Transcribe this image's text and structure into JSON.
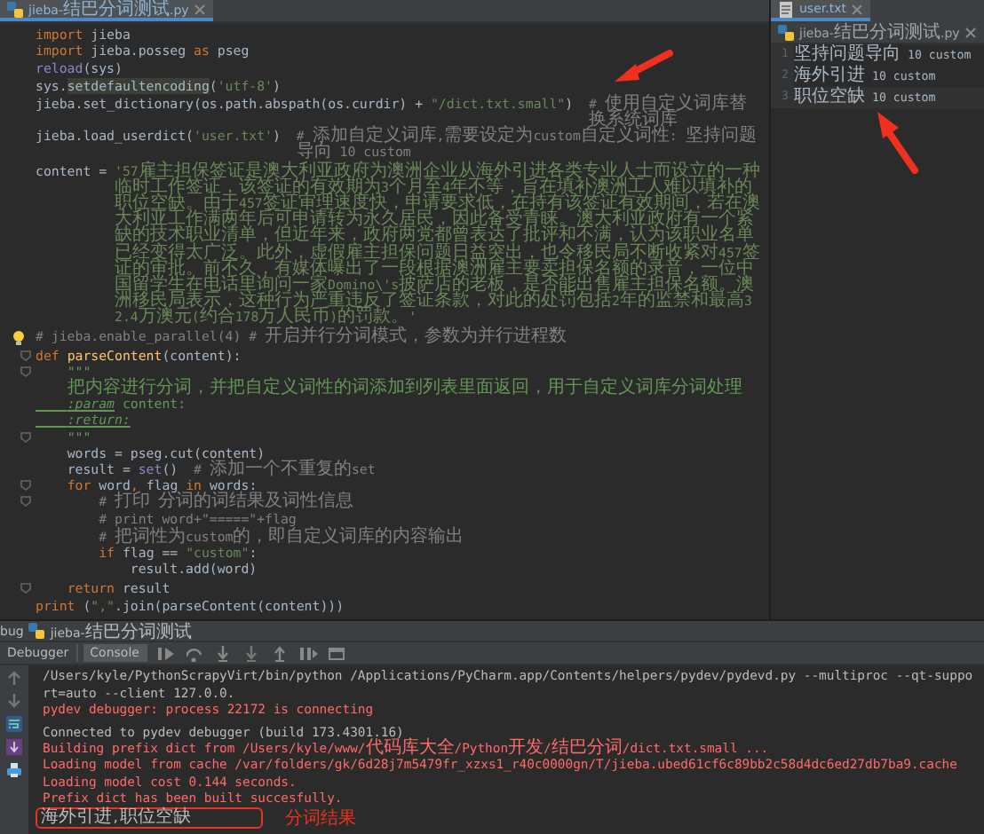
{
  "editor": {
    "tab": {
      "label": "jieba-结巴分词测试.py",
      "selected": true
    },
    "lines": [
      {
        "space_before": true,
        "fold": false,
        "bulb": false,
        "tokens": [
          {
            "kind": "keyword",
            "text": "import"
          },
          {
            "kind": "plain",
            "text": " jieba"
          }
        ]
      },
      {
        "space_before": false,
        "fold": false,
        "bulb": false,
        "tokens": [
          {
            "kind": "keyword",
            "text": "import"
          },
          {
            "kind": "plain",
            "text": " jieba.posseg "
          },
          {
            "kind": "keyword",
            "text": "as"
          },
          {
            "kind": "plain",
            "text": " pseg"
          }
        ]
      },
      {
        "space_before": true,
        "fold": false,
        "bulb": false,
        "tokens": [
          {
            "kind": "builtin",
            "text": "reload"
          },
          {
            "kind": "plain",
            "text": "(sys)"
          }
        ]
      },
      {
        "space_before": false,
        "fold": false,
        "bulb": false,
        "tokens": [
          {
            "kind": "plain",
            "text": "sys."
          },
          {
            "kind": "marked",
            "text": "setdefaultencoding"
          },
          {
            "kind": "plain",
            "text": "("
          },
          {
            "kind": "string",
            "text": "'utf-8'"
          },
          {
            "kind": "plain",
            "text": ")"
          }
        ]
      },
      {
        "space_before": true,
        "fold": false,
        "bulb": false,
        "tokens": [
          {
            "kind": "plain",
            "text": "jieba.set_dictionary(os.path.abspath(os.curdir) + "
          },
          {
            "kind": "string",
            "text": "\"/dict.txt.small\""
          },
          {
            "kind": "plain",
            "text": ")  "
          },
          {
            "kind": "comment",
            "text": "# 使用自定义词库替换系统词库"
          }
        ]
      },
      {
        "space_before": false,
        "fold": false,
        "bulb": false,
        "tokens": [
          {
            "kind": "plain",
            "text": "jieba.load_userdict("
          },
          {
            "kind": "string",
            "text": "'user.txt'"
          },
          {
            "kind": "plain",
            "text": ")  "
          },
          {
            "kind": "comment",
            "text": "# 添加自定义词库,需要设定为custom自定义词性: 坚持问题导向 10 custom"
          }
        ]
      },
      {
        "space_before": true,
        "fold": false,
        "bulb": false,
        "tokens": [
          {
            "kind": "plain",
            "text": "content = "
          },
          {
            "kind": "string",
            "text": "'57雇主担保签证是澳大利亚政府为澳洲企业从海外引进各类专业人士而设立的一种临时工作签证，该签证的有效期为3个月至4年不等，旨在填补澳洲工人难以填补的职位空缺。由于457签证审理速度快，申请要求低，在持有该签证有效期间，若在澳大利亚工作满两年后可申请转为永久居民，因此备受青睐。澳大利亚政府有一个紧缺的技术职业清单，但近年来，政府两党都曾表达了批评和不满，认为该职业名单已经变得太广泛。此外，虚假雇主担保问题日益突出，也令移民局不断收紧对457签证的审批。前不久，有媒体曝出了一段根据澳洲雇主要卖担保名额的录音，一位中国留学生在电话里询问一家Domino\\'s披萨店的老板，是否能出售雇主担保名额。澳洲移民局表示，这种行为严重违反了签证条款，对此的处罚包括2年的监禁和最高32.4万澳元(约合178万人民币)的罚款。'"
          }
        ]
      },
      {
        "space_before": true,
        "fold": false,
        "bulb": true,
        "tokens": [
          {
            "kind": "comment",
            "text": "# jieba.enable_parallel(4) # 开启并行分词模式，参数为并行进程数"
          }
        ]
      },
      {
        "space_before": true,
        "fold": true,
        "bulb": false,
        "tokens": [
          {
            "kind": "keyword",
            "text": "def "
          },
          {
            "kind": "function",
            "text": "parseContent"
          },
          {
            "kind": "plain",
            "text": "(content):"
          }
        ]
      },
      {
        "space_before": false,
        "fold": true,
        "bulb": false,
        "tokens": [
          {
            "kind": "doc",
            "text": "    \"\"\""
          }
        ]
      },
      {
        "space_before": false,
        "fold": false,
        "bulb": false,
        "tokens": [
          {
            "kind": "doc",
            "text": "    把内容进行分词，并把自定义词性的词添加到列表里面返回，用于自定义词库分词处理"
          }
        ]
      },
      {
        "space_before": false,
        "fold": false,
        "bulb": false,
        "tokens": [
          {
            "kind": "doctag",
            "text": "    :param"
          },
          {
            "kind": "doc",
            "text": " content:"
          }
        ]
      },
      {
        "space_before": false,
        "fold": false,
        "bulb": false,
        "tokens": [
          {
            "kind": "doctag",
            "text": "    :return:"
          }
        ]
      },
      {
        "space_before": false,
        "fold": true,
        "bulb": false,
        "tokens": [
          {
            "kind": "doc",
            "text": "    \"\"\""
          }
        ]
      },
      {
        "space_before": false,
        "fold": false,
        "bulb": false,
        "tokens": [
          {
            "kind": "plain",
            "text": "    words = pseg.cut(content)"
          }
        ]
      },
      {
        "space_before": false,
        "fold": false,
        "bulb": false,
        "tokens": [
          {
            "kind": "plain",
            "text": "    result = "
          },
          {
            "kind": "builtin",
            "text": "set"
          },
          {
            "kind": "plain",
            "text": "()  "
          },
          {
            "kind": "comment",
            "text": "# 添加一个不重复的set"
          }
        ]
      },
      {
        "space_before": false,
        "fold": true,
        "bulb": false,
        "tokens": [
          {
            "kind": "keyword",
            "text": "    for"
          },
          {
            "kind": "plain",
            "text": " word"
          },
          {
            "kind": "keyword",
            "text": ","
          },
          {
            "kind": "plain",
            "text": " flag "
          },
          {
            "kind": "keyword",
            "text": "in"
          },
          {
            "kind": "plain",
            "text": " words:"
          }
        ]
      },
      {
        "space_before": false,
        "fold": true,
        "bulb": false,
        "tokens": [
          {
            "kind": "comment",
            "text": "        # 打印 分词的词结果及词性信息"
          }
        ]
      },
      {
        "space_before": false,
        "fold": false,
        "bulb": false,
        "tokens": [
          {
            "kind": "comment",
            "text": "        # print word+\"=====\"+flag"
          }
        ]
      },
      {
        "space_before": true,
        "fold": false,
        "bulb": false,
        "tokens": [
          {
            "kind": "comment",
            "text": "        # 把词性为custom的，即自定义词库的内容输出"
          }
        ]
      },
      {
        "space_before": false,
        "fold": false,
        "bulb": false,
        "tokens": [
          {
            "kind": "keyword",
            "text": "        if"
          },
          {
            "kind": "plain",
            "text": " flag == "
          },
          {
            "kind": "string",
            "text": "\"custom\""
          },
          {
            "kind": "plain",
            "text": ":"
          }
        ]
      },
      {
        "space_before": false,
        "fold": false,
        "bulb": false,
        "tokens": [
          {
            "kind": "plain",
            "text": "            result.add(word)"
          }
        ]
      },
      {
        "space_before": true,
        "fold": true,
        "bulb": false,
        "tokens": [
          {
            "kind": "keyword",
            "text": "    return"
          },
          {
            "kind": "plain",
            "text": " result"
          }
        ]
      },
      {
        "space_before": true,
        "fold": false,
        "bulb": false,
        "tokens": [
          {
            "kind": "keyword",
            "text": "print"
          },
          {
            "kind": "plain",
            "text": " ("
          },
          {
            "kind": "string",
            "text": "\",\""
          },
          {
            "kind": "plain",
            "text": ".join(parseContent(content)))"
          }
        ]
      }
    ]
  },
  "user_pane": {
    "tabs": [
      {
        "label": "user.txt",
        "kind": "text",
        "selected": true
      },
      {
        "label": "jieba-结巴分词测试.py",
        "kind": "python",
        "selected": false
      }
    ],
    "lines": [
      {
        "number": "1",
        "text": "坚持问题导向 10 custom",
        "current": false
      },
      {
        "number": "2",
        "text": "海外引进 10 custom",
        "current": false
      },
      {
        "number": "3",
        "text": "职位空缺 10 custom",
        "current": true
      }
    ]
  },
  "debug": {
    "tool_label": "bug",
    "config": "jieba-结巴分词测试",
    "tabs": [
      {
        "label": "Debugger",
        "selected": false
      },
      {
        "label": "Console",
        "selected": true
      }
    ],
    "lines": [
      {
        "kind": "stdout",
        "boxed": false,
        "space_before": false,
        "text": "/Users/kyle/PythonScrapyVirt/bin/python /Applications/PyCharm.app/Contents/helpers/pydev/pydevd.py --multiproc --qt-support=auto --client 127.0.0."
      },
      {
        "kind": "stderr",
        "boxed": false,
        "space_before": false,
        "text": "pydev debugger: process 22172 is connecting"
      },
      {
        "kind": "stdout",
        "boxed": false,
        "space_before": true,
        "text": "Connected to pydev debugger (build 173.4301.16)"
      },
      {
        "kind": "stderr",
        "boxed": false,
        "space_before": false,
        "text": "Building prefix dict from /Users/kyle/www/代码库大全/Python开发/结巴分词/dict.txt.small ..."
      },
      {
        "kind": "stderr",
        "boxed": false,
        "space_before": false,
        "text": "Loading model from cache /var/folders/gk/6d28j7m5479fr_xzxs1_r40c0000gn/T/jieba.ubed61cf6c89bb2c58d4dc6ed27db7ba9.cache"
      },
      {
        "kind": "stderr",
        "boxed": false,
        "space_before": false,
        "text": "Loading model cost 0.144 seconds."
      },
      {
        "kind": "stderr",
        "boxed": false,
        "space_before": false,
        "text": "Prefix dict has been built succesfully."
      },
      {
        "kind": "stdout",
        "boxed": true,
        "space_before": false,
        "text": "海外引进,职位空缺"
      }
    ],
    "result_note": "分词结果"
  }
}
